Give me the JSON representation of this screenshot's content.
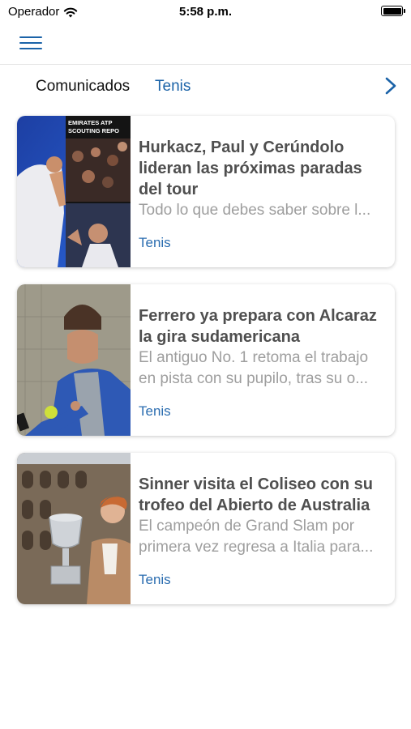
{
  "status": {
    "carrier": "Operador",
    "time": "5:58 p.m."
  },
  "tabs": [
    {
      "label": "Comunicados"
    },
    {
      "label": "Tenis"
    }
  ],
  "thumb_text": {
    "line1": "EMIRATES ATP",
    "line2": "SCOUTING REPO"
  },
  "articles": [
    {
      "title_lines": [
        "Hurkacz, Paul y Cerúndolo",
        "lideran las próximas paradas",
        "del tour"
      ],
      "summary_lines": [
        "Todo lo que debes saber sobre l..."
      ],
      "tag": "Tenis"
    },
    {
      "title_lines": [
        "Ferrero ya prepara con Alcaraz",
        "la gira sudamericana"
      ],
      "summary_lines": [
        "El antiguo No. 1 retoma el trabajo",
        "en pista con su pupilo, tras su o..."
      ],
      "tag": "Tenis"
    },
    {
      "title_lines": [
        "Sinner visita el Coliseo con su",
        "trofeo del Abierto de Australia"
      ],
      "summary_lines": [
        "El campeón de Grand Slam por",
        "primera vez regresa a Italia para..."
      ],
      "tag": "Tenis"
    }
  ]
}
